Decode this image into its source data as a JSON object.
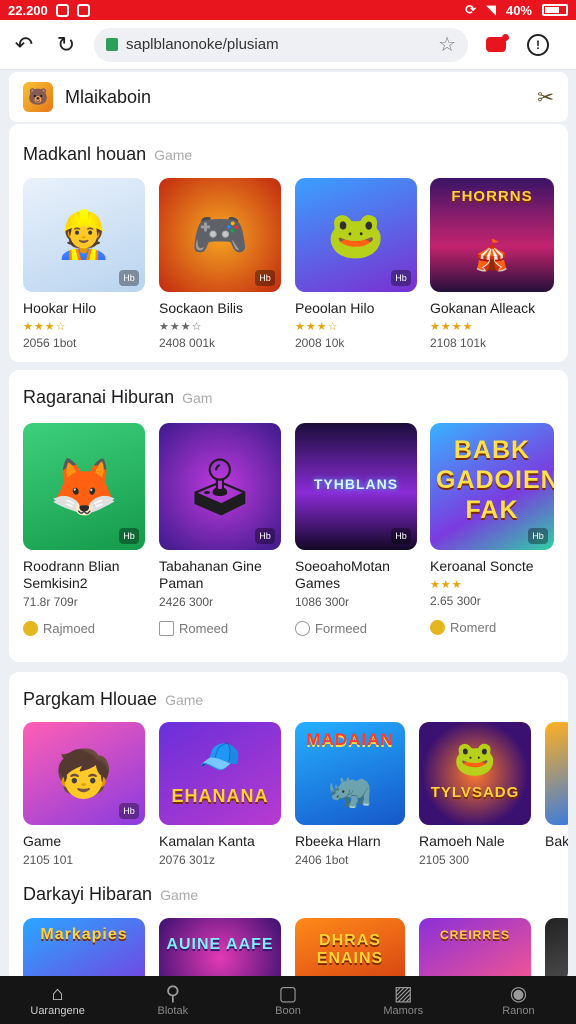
{
  "status_bar": {
    "time": "22.200",
    "battery": "40%"
  },
  "browser": {
    "url": "saplblanonoke/plusiam"
  },
  "app": {
    "title": "Mlaikaboin"
  },
  "sections": [
    {
      "title": "Madkanl houan",
      "subtitle": "Game",
      "cards": [
        {
          "name": "Hookar Hilo",
          "stars": "★★★☆",
          "meta": "2056 1bot"
        },
        {
          "name": "Sockaon Bilis",
          "stars": "★★★☆",
          "meta": "2408 001k"
        },
        {
          "name": "Peoolan Hilo",
          "stars": "★★★☆",
          "meta": "2008 10k"
        },
        {
          "name": "Gokanan Alleack",
          "stars": "★★★★",
          "meta": "2108 101k"
        }
      ]
    },
    {
      "title": "Ragaranai Hiburan",
      "subtitle": "Gam",
      "cards": [
        {
          "name": "Roodrann Blian Semkisin2",
          "stars": "",
          "meta": "71.8r 709r",
          "action": "Rajmoed"
        },
        {
          "name": "Tabahanan Gine Paman",
          "stars": "",
          "meta": "2426 300r",
          "action": "Romeed"
        },
        {
          "name": "SoeoahoMotan Games",
          "stars": "",
          "meta": "1086 300r",
          "action": "Formeed"
        },
        {
          "name": "Keroanal Soncte",
          "stars": "★★★",
          "meta": "2.65 300r",
          "action": "Romerd"
        }
      ]
    },
    {
      "title": "Pargkam Hlouae",
      "subtitle": "Game",
      "cards": [
        {
          "name": "Game",
          "meta": "2105 101"
        },
        {
          "name": "Kamalan Kanta",
          "meta": "2076 301z"
        },
        {
          "name": "Rbeeka Hlarn",
          "meta": "2406 1bot"
        },
        {
          "name": "Ramoeh Nale",
          "meta": "2105 300"
        },
        {
          "name": "Bak",
          "meta": ""
        }
      ]
    },
    {
      "title": "Darkayi Hibaran",
      "subtitle": "Game"
    }
  ],
  "thumb_text": {
    "s1c3": "FHORRNS",
    "s2c2": "TYHBLANS",
    "s2c3": "BABK GADOIEN FAK",
    "s3c0": "MADAIAN",
    "s3c1": "EHANANA",
    "s3c3": "TYLVSADG",
    "s4c0": "Markapies",
    "s4c1": "AUINE AAFE",
    "s4c2": "DHRAS ENAINS",
    "s4c3": "CREIRRES"
  },
  "bottom_nav": [
    {
      "label": "Uarangene",
      "icon": "home-icon"
    },
    {
      "label": "Blotak",
      "icon": "search-icon"
    },
    {
      "label": "Boon",
      "icon": "library-icon"
    },
    {
      "label": "Mamors",
      "icon": "image-icon"
    },
    {
      "label": "Ranon",
      "icon": "profile-icon"
    }
  ]
}
